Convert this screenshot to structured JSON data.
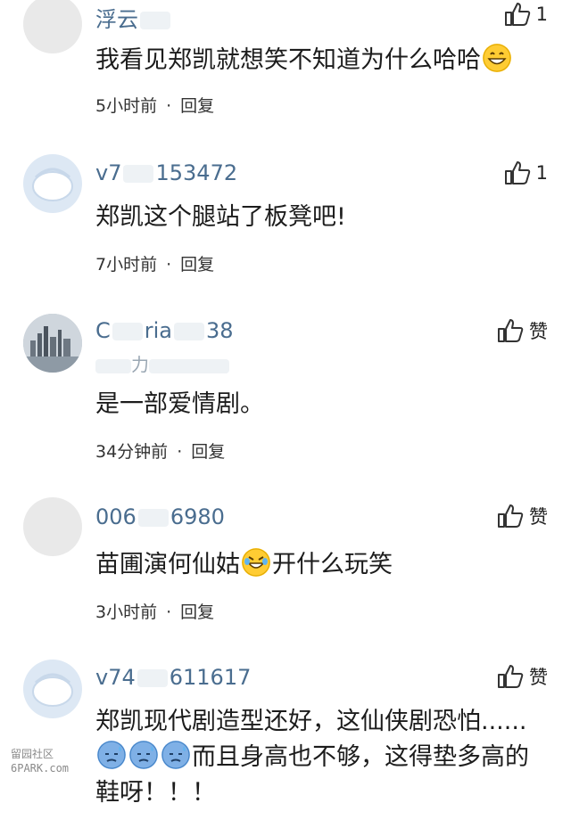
{
  "comments": [
    {
      "username_start": "浮云",
      "username_end": "",
      "text": "我看见郑凯就想笑不知道为什么哈哈",
      "emoji": "grinning-face",
      "time": "5小时前",
      "reply": "回复",
      "likes": "1"
    },
    {
      "username_start": "v7",
      "username_end": "153472",
      "text": "郑凯这个腿站了板凳吧!",
      "time": "7小时前",
      "reply": "回复",
      "likes": "1"
    },
    {
      "username_start": "C",
      "username_middle": "ria",
      "username_end": "38",
      "subline": "力",
      "text": "是一部爱情剧。",
      "time": "34分钟前",
      "reply": "回复",
      "likes": "赞"
    },
    {
      "username_start": "006",
      "username_end": "6980",
      "text_before": "苗圃演何仙姑",
      "emoji": "rolling-laughing-face",
      "text_after": "开什么玩笑",
      "time": "3小时前",
      "reply": "回复",
      "likes": "赞"
    },
    {
      "username_start": "v74",
      "username_end": "611617",
      "text_line1": "郑凯现代剧造型还好，这仙侠剧恐怕......",
      "emoji": "downcast-sweat-face",
      "text_line2_after": "而且身高也不够，这得垫多高的",
      "text_line3": "鞋呀！！！",
      "likes": "赞"
    }
  ],
  "watermark": {
    "line1": "留园社区",
    "line2": "6PARK.com"
  },
  "colors": {
    "username": "#4a6d8f",
    "text": "#1c1c1c",
    "meta": "#333333"
  }
}
